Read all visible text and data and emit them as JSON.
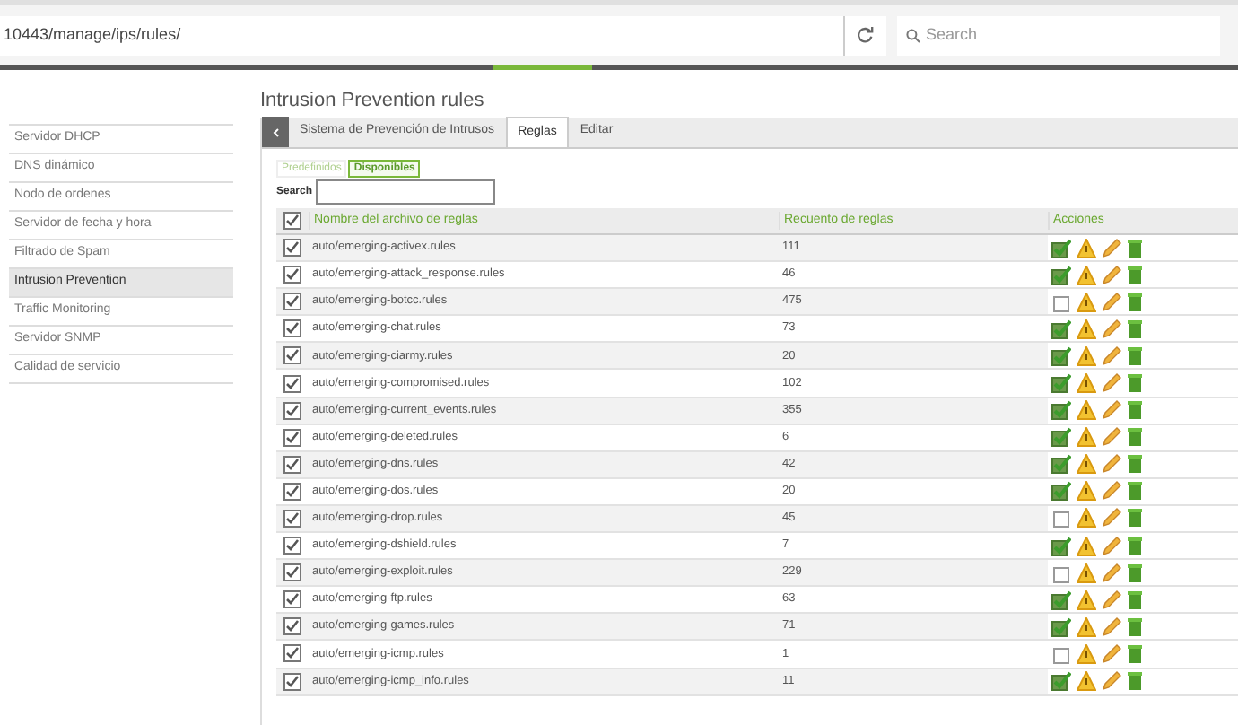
{
  "browser": {
    "url": "10443/manage/ips/rules/",
    "search": {
      "placeholder": "Search"
    }
  },
  "sidebar": {
    "items": [
      {
        "label": "Servidor DHCP",
        "selected": false
      },
      {
        "label": "DNS dinámico",
        "selected": false
      },
      {
        "label": "Nodo de ordenes",
        "selected": false
      },
      {
        "label": "Servidor de fecha y hora",
        "selected": false
      },
      {
        "label": "Filtrado de Spam",
        "selected": false
      },
      {
        "label": "Intrusion Prevention",
        "selected": true
      },
      {
        "label": "Traffic Monitoring",
        "selected": false
      },
      {
        "label": "Servidor SNMP",
        "selected": false
      },
      {
        "label": "Calidad de servicio",
        "selected": false
      }
    ]
  },
  "page_title": "Intrusion Prevention rules",
  "tabs": [
    {
      "label": "Sistema de Prevención de Intrusos",
      "selected": false
    },
    {
      "label": "Reglas",
      "selected": true
    },
    {
      "label": "Editar",
      "selected": false
    }
  ],
  "filters": [
    {
      "label": "Predefinidos",
      "selected": false
    },
    {
      "label": "Disponibles",
      "selected": true
    }
  ],
  "search": {
    "label": "Search"
  },
  "table": {
    "columns": [
      "Nombre del archivo de reglas",
      "Recuento de reglas",
      "Acciones"
    ],
    "all_checked": true,
    "rows": [
      {
        "name": "auto/emerging-activex.rules",
        "count": "111",
        "checked": true,
        "enabled": true
      },
      {
        "name": "auto/emerging-attack_response.rules",
        "count": "46",
        "checked": true,
        "enabled": true
      },
      {
        "name": "auto/emerging-botcc.rules",
        "count": "475",
        "checked": true,
        "enabled": false
      },
      {
        "name": "auto/emerging-chat.rules",
        "count": "73",
        "checked": true,
        "enabled": true
      },
      {
        "name": "auto/emerging-ciarmy.rules",
        "count": "20",
        "checked": true,
        "enabled": true
      },
      {
        "name": "auto/emerging-compromised.rules",
        "count": "102",
        "checked": true,
        "enabled": true
      },
      {
        "name": "auto/emerging-current_events.rules",
        "count": "355",
        "checked": true,
        "enabled": true
      },
      {
        "name": "auto/emerging-deleted.rules",
        "count": "6",
        "checked": true,
        "enabled": true
      },
      {
        "name": "auto/emerging-dns.rules",
        "count": "42",
        "checked": true,
        "enabled": true
      },
      {
        "name": "auto/emerging-dos.rules",
        "count": "20",
        "checked": true,
        "enabled": true
      },
      {
        "name": "auto/emerging-drop.rules",
        "count": "45",
        "checked": true,
        "enabled": false
      },
      {
        "name": "auto/emerging-dshield.rules",
        "count": "7",
        "checked": true,
        "enabled": true
      },
      {
        "name": "auto/emerging-exploit.rules",
        "count": "229",
        "checked": true,
        "enabled": false
      },
      {
        "name": "auto/emerging-ftp.rules",
        "count": "63",
        "checked": true,
        "enabled": true
      },
      {
        "name": "auto/emerging-games.rules",
        "count": "71",
        "checked": true,
        "enabled": true
      },
      {
        "name": "auto/emerging-icmp.rules",
        "count": "1",
        "checked": true,
        "enabled": false
      },
      {
        "name": "auto/emerging-icmp_info.rules",
        "count": "11",
        "checked": true,
        "enabled": true
      }
    ]
  }
}
